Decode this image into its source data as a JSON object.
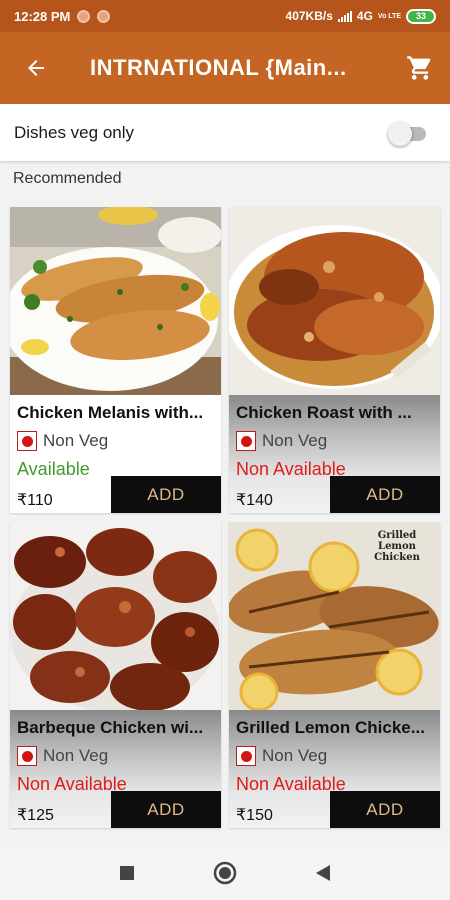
{
  "status_bar": {
    "time": "12:28 PM",
    "network_speed": "407KB/s",
    "network_type": "4G",
    "volte_label": "Vo LTE",
    "battery": "33"
  },
  "app_bar": {
    "title": "INTRNATIONAL {Main...",
    "back_icon": "arrow-left-icon",
    "cart_icon": "shopping-cart-icon"
  },
  "filter": {
    "veg_only_label": "Dishes veg only",
    "veg_only_enabled": false
  },
  "section": {
    "label": "Recommended"
  },
  "dishes": [
    {
      "name": "Chicken Melanis with...",
      "diet": "Non Veg",
      "availability": "Available",
      "available": true,
      "price": "₹110",
      "add_label": "ADD"
    },
    {
      "name": "Chicken Roast with ...",
      "diet": "Non Veg",
      "availability": "Non Available",
      "available": false,
      "price": "₹140",
      "add_label": "ADD"
    },
    {
      "name": "Barbeque Chicken wi...",
      "diet": "Non Veg",
      "availability": "Non Available",
      "available": false,
      "price": "₹125",
      "add_label": "ADD"
    },
    {
      "name": "Grilled Lemon Chicke...",
      "diet": "Non Veg",
      "availability": "Non Available",
      "available": false,
      "price": "₹150",
      "add_label": "ADD",
      "photo_caption": "Grilled Lemon Chicken"
    }
  ],
  "colors": {
    "status_bar": "#b5541b",
    "app_bar": "#c56523",
    "available": "#3f9b2c",
    "not_available": "#e01b1b",
    "add_button": "#0d0d0d",
    "add_button_text": "#e0b98a"
  },
  "nav_bar": {
    "icons": [
      "recents-square-icon",
      "home-circle-icon",
      "back-triangle-icon"
    ]
  }
}
